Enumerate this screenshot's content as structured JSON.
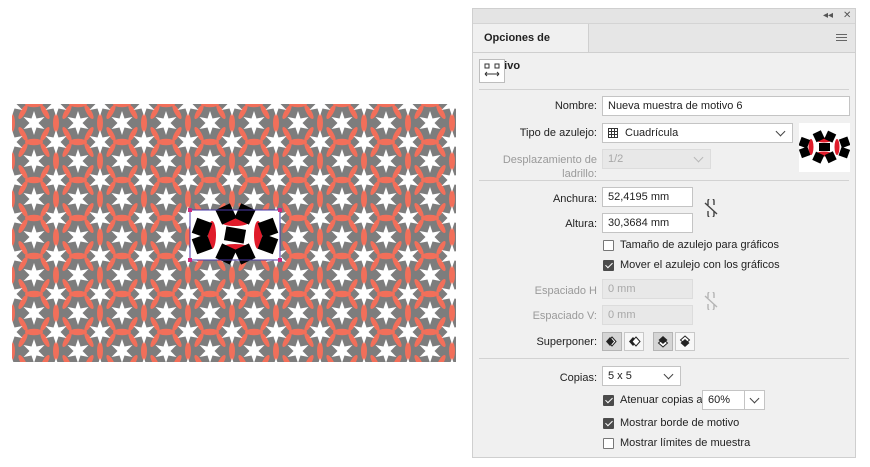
{
  "panel": {
    "tab_title": "Opciones de motivo",
    "collapse_glyph": "◂◂",
    "close_glyph": "✕",
    "labels": {
      "name": "Nombre:",
      "tile_type": "Tipo de azulejo:",
      "brick_offset": "Desplazamiento de ladrillo:",
      "width": "Anchura:",
      "height": "Altura:",
      "h_spacing": "Espaciado H",
      "v_spacing": "Espaciado V:",
      "overlap": "Superponer:",
      "copies": "Copias:"
    },
    "values": {
      "name": "Nueva muestra de motivo 6",
      "tile_type": "Cuadrícula",
      "brick_offset": "1/2",
      "width": "52,4195 mm",
      "height": "30,3684 mm",
      "h_spacing": "0 mm",
      "v_spacing": "0 mm",
      "copies": "5 x 5",
      "dim_percent": "60%"
    },
    "checkboxes": {
      "size_tile_to_art": "Tamaño de azulejo para gráficos",
      "move_tile_with_art": "Mover el azulejo con los gráficos",
      "dim_copies": "Atenuar copias a:",
      "show_tile_edge": "Mostrar borde de motivo",
      "show_swatch_bounds": "Mostrar límites de muestra"
    },
    "checkbox_states": {
      "size_tile_to_art": false,
      "move_tile_with_art": true,
      "dim_copies": true,
      "show_tile_edge": true,
      "show_swatch_bounds": false
    },
    "icons": {
      "tile_tool": "pattern-tile-tool-icon",
      "tile_type": "grid-icon",
      "link": "link-broken-icon"
    }
  },
  "colors": {
    "panel_bg": "#f0f0f0",
    "pattern_gray": "#7d7d7d",
    "pattern_coral": "#f26f5a",
    "tile_red": "#e01b2a",
    "tile_black": "#000000",
    "tile_border": "#4a3aa8",
    "tile_corner": "#d0287a"
  }
}
